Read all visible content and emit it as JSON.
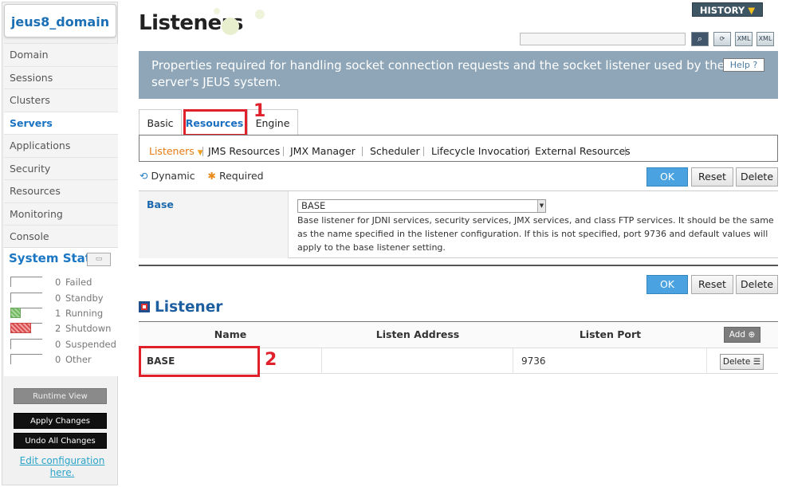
{
  "sidebar": {
    "domain": "jeus8_domain",
    "nav": [
      "Domain",
      "Sessions",
      "Clusters",
      "Servers",
      "Applications",
      "Security",
      "Resources",
      "Monitoring",
      "Console"
    ],
    "active_nav": "Servers",
    "system_status_title": "System Status",
    "status": [
      {
        "count": "0",
        "label": "Failed"
      },
      {
        "count": "0",
        "label": "Standby"
      },
      {
        "count": "1",
        "label": "Running"
      },
      {
        "count": "2",
        "label": "Shutdown"
      },
      {
        "count": "0",
        "label": "Suspended"
      },
      {
        "count": "0",
        "label": "Other"
      }
    ],
    "runtime_view": "Runtime View",
    "apply_changes": "Apply Changes",
    "undo_changes": "Undo All Changes",
    "edit_config": "Edit configuration here."
  },
  "header": {
    "title": "Listeners",
    "history": "HISTORY",
    "search_placeholder": "",
    "description": "Properties required for handling socket connection requests and the socket listener used by the server's JEUS system.",
    "help": "Help"
  },
  "tabs": [
    "Basic",
    "Resources",
    "Engine"
  ],
  "subtabs": [
    "Listeners",
    "JMS Resources",
    "JMX Manager",
    "Scheduler",
    "Lifecycle Invocation",
    "External Resources"
  ],
  "legend": {
    "dynamic": "Dynamic",
    "required": "Required"
  },
  "buttons": {
    "ok": "OK",
    "reset": "Reset",
    "delete": "Delete",
    "add": "Add"
  },
  "base": {
    "label": "Base",
    "selected": "BASE",
    "description": "Base listener for JDNI services, security services, JMX services, and class FTP services. It should be the same as the name specified in the listener configuration. If this is not specified, port 9736 and default values will apply to the base listener setting."
  },
  "listener": {
    "title": "Listener",
    "columns": [
      "Name",
      "Listen Address",
      "Listen Port"
    ],
    "rows": [
      {
        "name": "BASE",
        "address": "",
        "port": "9736"
      }
    ]
  },
  "annotations": [
    "1",
    "2"
  ]
}
